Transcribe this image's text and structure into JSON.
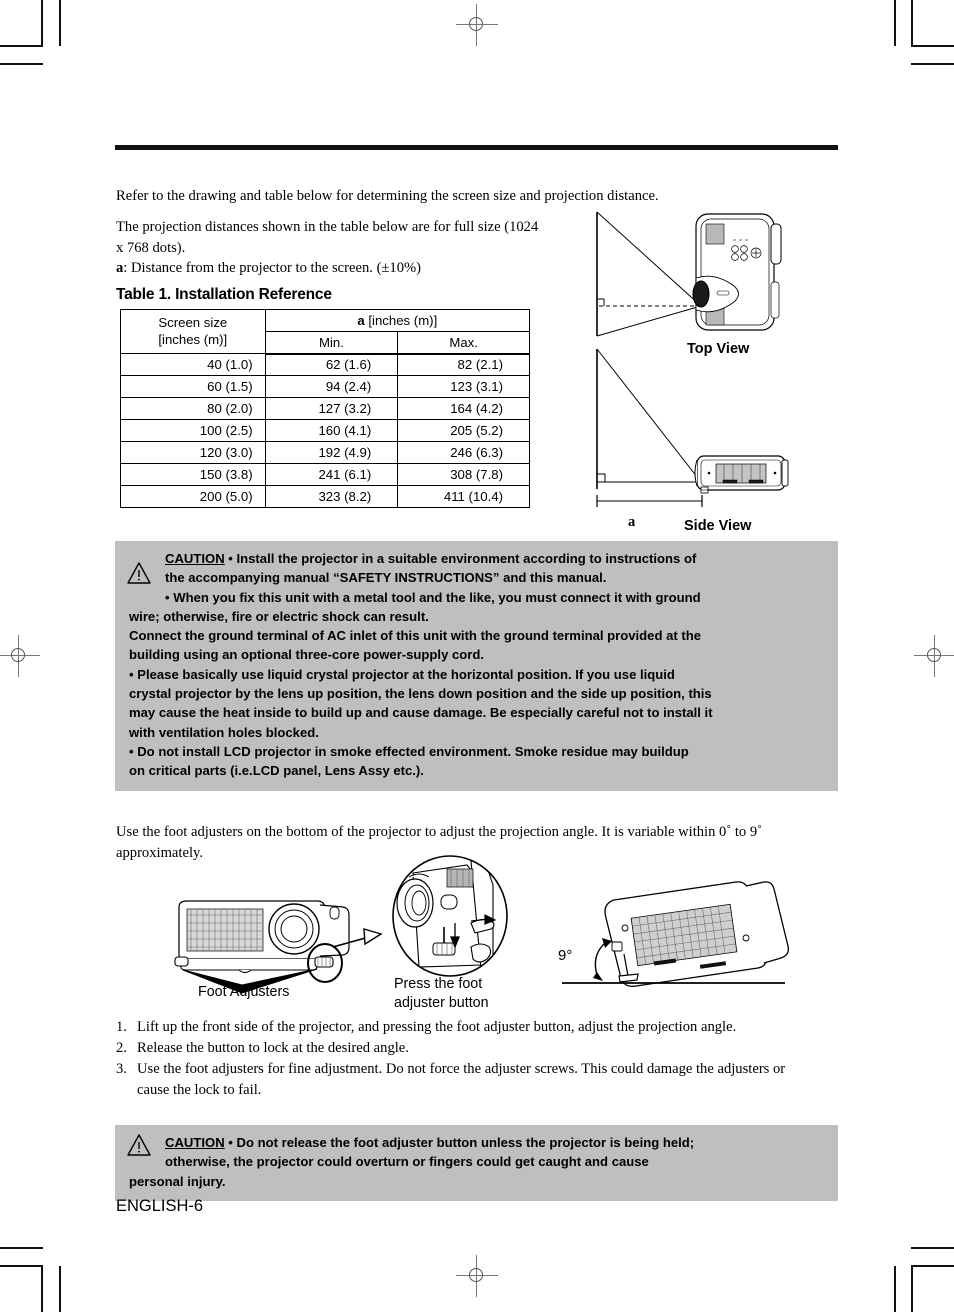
{
  "page": {
    "footer": "ENGLISH-6"
  },
  "intro": {
    "line1": "Refer to the drawing and table below for determining the screen size and projection distance.",
    "line2": "The projection distances shown in the table below are for full size (1024 x 768 dots).",
    "a_label": "a",
    "a_desc": ": Distance from the projector to the screen. (±10%)"
  },
  "table": {
    "title": "Table 1. Installation Reference",
    "headers": {
      "screen_size": "Screen size",
      "screen_size_unit": "[inches (m)]",
      "a_group_label": "a",
      "a_group_unit": " [inches (m)]",
      "min": "Min.",
      "max": "Max."
    },
    "rows": [
      {
        "screen": "40  (1.0)",
        "min": "62  (1.6)",
        "max": "82  (2.1)"
      },
      {
        "screen": "60  (1.5)",
        "min": "94  (2.4)",
        "max": "123  (3.1)"
      },
      {
        "screen": "80  (2.0)",
        "min": "127  (3.2)",
        "max": "164  (4.2)"
      },
      {
        "screen": "100  (2.5)",
        "min": "160  (4.1)",
        "max": "205  (5.2)"
      },
      {
        "screen": "120  (3.0)",
        "min": "192  (4.9)",
        "max": "246  (6.3)"
      },
      {
        "screen": "150  (3.8)",
        "min": "241  (6.1)",
        "max": "308  (7.8)"
      },
      {
        "screen": "200  (5.0)",
        "min": "323  (8.2)",
        "max": "411 (10.4)"
      }
    ]
  },
  "diagram": {
    "top_view_label": "Top View",
    "side_view_label": "Side View",
    "distance_label": "a"
  },
  "caution_main": {
    "heading": "CAUTION",
    "line1": " • Install the projector in a suitable environment according to instructions of",
    "line2": "the accompanying manual “SAFETY INSTRUCTIONS” and this manual.",
    "line3": "• When you fix this unit with a metal tool and the like, you must connect it with ground",
    "line4": "wire; otherwise, fire or electric shock can result.",
    "line5": "Connect the ground terminal of AC inlet of this unit with the ground terminal provided at the",
    "line6": "building using an optional three-core power-supply cord.",
    "line7": "• Please basically use liquid crystal projector at the horizontal position. If you use liquid",
    "line8": "crystal projector by the lens up position, the lens down position and the side up position, this",
    "line9": "may cause the heat inside to build up and cause damage. Be especially careful not to install it",
    "line10": "with ventilation holes blocked.",
    "line11": "• Do not install LCD projector in smoke effected environment. Smoke residue may buildup",
    "line12": "on critical parts (i.e.LCD panel, Lens Assy etc.)."
  },
  "foot_section": {
    "intro": "Use the foot adjusters on the bottom of the projector to adjust the projection angle. It is variable within 0˚ to 9˚ approximately.",
    "caption_foot_adjusters": "Foot Adjusters",
    "caption_press_line1": "Press the foot",
    "caption_press_line2": "adjuster button",
    "angle_label": "9°",
    "steps": [
      {
        "n": "1.",
        "text": "Lift up the front side of the projector, and pressing the foot adjuster button, adjust the projection angle."
      },
      {
        "n": "2.",
        "text": "Release the button to lock at the desired angle."
      },
      {
        "n": "3.",
        "text": "Use the foot adjusters for fine adjustment. Do not force the adjuster screws. This could damage the adjusters or cause the lock to fail."
      }
    ]
  },
  "caution_foot": {
    "heading": "CAUTION",
    "line1": " • Do not release the foot adjuster button unless the projector is being held;",
    "line2": "otherwise, the projector could overturn or fingers could get caught and cause",
    "line3": "personal injury."
  },
  "colors": {
    "caution_bg": "#bfbfbf",
    "rule": "#111111"
  }
}
